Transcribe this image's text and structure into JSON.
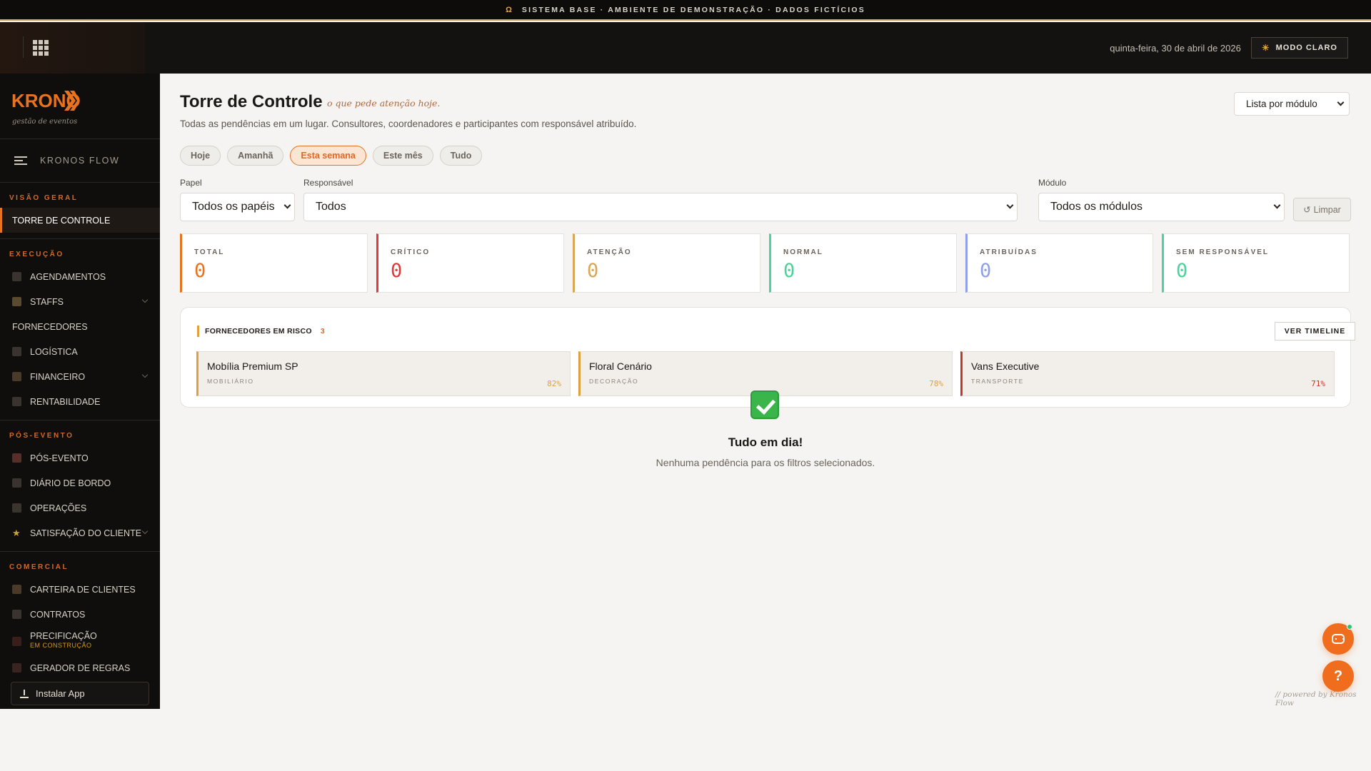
{
  "banner": {
    "omega": "Ω",
    "text": "SISTEMA BASE · AMBIENTE DE DEMONSTRAÇÃO · DADOS FICTÍCIOS"
  },
  "header": {
    "date": "quinta-feira, 30 de abril de 2026",
    "mode_button": "MODO CLARO",
    "mode_icon": "sun-icon",
    "apps_icon": "grid-icon"
  },
  "sidebar": {
    "logo_text": "KRONOS",
    "logo_sub": "gestão de eventos",
    "app_name": "KRONOS FLOW",
    "sections": [
      {
        "title": "VISÃO GERAL"
      },
      {
        "title": "EXECUÇÃO"
      },
      {
        "title": "PÓS-EVENTO"
      },
      {
        "title": "COMERCIAL"
      }
    ],
    "items": {
      "torre": "TORRE DE CONTROLE",
      "agendamentos": "AGENDAMENTOS",
      "staffs": "STAFFS",
      "fornecedores": "FORNECEDORES",
      "logistica": "LOGÍSTICA",
      "financeiro": "FINANCEIRO",
      "rentabilidade": "RENTABILIDADE",
      "pos_evento": "PÓS-EVENTO",
      "diario": "DIÁRIO DE BORDO",
      "operacoes": "OPERAÇÕES",
      "satisfacao": "SATISFAÇÃO DO CLIENTE",
      "carteira": "CARTEIRA DE CLIENTES",
      "contratos": "CONTRATOS",
      "precificacao": "PRECIFICAÇÃO",
      "precificacao_badge": "EM CONSTRUÇÃO",
      "gerador": "GERADOR DE REGRAS"
    },
    "install": "Instalar App"
  },
  "main": {
    "title": "Torre de Controle",
    "tagline": "o que pede atenção hoje.",
    "description": "Todas as pendências em um lugar. Consultores, coordenadores e participantes com responsável atribuído.",
    "view_select": "Lista por módulo",
    "chips": [
      "Hoje",
      "Amanhã",
      "Esta semana",
      "Este mês",
      "Tudo"
    ],
    "active_chip": "Esta semana",
    "filters": {
      "papel_label": "Papel",
      "papel_value": "Todos os papéis",
      "responsavel_label": "Responsável",
      "responsavel_value": "Todos",
      "modulo_label": "Módulo",
      "modulo_value": "Todos os módulos",
      "clear": "Limpar"
    },
    "stats": [
      {
        "label": "TOTAL",
        "value": "0",
        "color": "#e8731f"
      },
      {
        "label": "CRÍTICO",
        "value": "0",
        "color": "#e03a3a"
      },
      {
        "label": "ATENÇÃO",
        "value": "0",
        "color": "#d9a656"
      },
      {
        "label": "NORMAL",
        "value": "0",
        "color": "#4cd39a"
      },
      {
        "label": "ATRIBUÍDAS",
        "value": "0",
        "color": "#8ea0e8"
      },
      {
        "label": "SEM RESPONSÁVEL",
        "value": "0",
        "color": "#4cd39a"
      }
    ],
    "risk": {
      "title": "FORNECEDORES EM RISCO",
      "count": "3",
      "timeline_button": "VER TIMELINE",
      "suppliers": [
        {
          "name": "Mobília Premium SP",
          "category": "MOBILIÁRIO",
          "pct": "82%",
          "color": "#e0a040"
        },
        {
          "name": "Floral Cenário",
          "category": "DECORAÇÃO",
          "pct": "78%",
          "color": "#e0a040"
        },
        {
          "name": "Vans Executive",
          "category": "TRANSPORTE",
          "pct": "71%",
          "color": "#c0392b"
        }
      ]
    },
    "empty": {
      "icon": "check-icon",
      "title": "Tudo em dia!",
      "description": "Nenhuma pendência para os filtros selecionados."
    },
    "powered": "// powered by Kronos Flow"
  },
  "fabs": {
    "chat_icon": "chat-icon",
    "help_label": "?"
  }
}
